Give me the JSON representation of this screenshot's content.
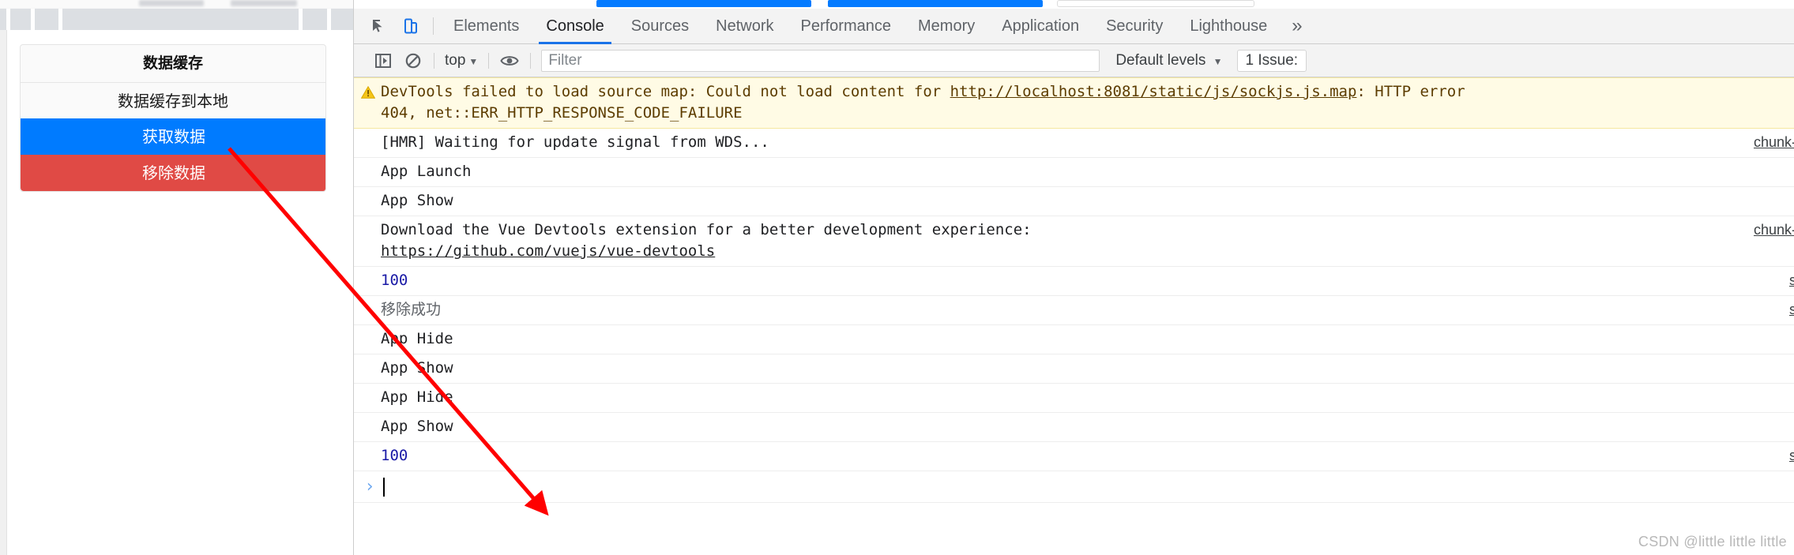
{
  "page": {
    "card_title": "数据缓存",
    "list_item": "数据缓存到本地",
    "primary_button": "获取数据",
    "danger_button": "移除数据",
    "primary_color": "#007bff",
    "danger_color": "#e04a45"
  },
  "devtools": {
    "tabs": [
      {
        "label": "Elements",
        "active": false
      },
      {
        "label": "Console",
        "active": true
      },
      {
        "label": "Sources",
        "active": false
      },
      {
        "label": "Network",
        "active": false
      },
      {
        "label": "Performance",
        "active": false
      },
      {
        "label": "Memory",
        "active": false
      },
      {
        "label": "Application",
        "active": false
      },
      {
        "label": "Security",
        "active": false
      },
      {
        "label": "Lighthouse",
        "active": false
      }
    ],
    "more_label": "»",
    "icons": {
      "inspect": "inspect-element-icon",
      "device": "device-toolbar-icon",
      "sidebar": "console-sidebar-icon",
      "clear": "clear-console-icon",
      "eye": "live-expression-icon"
    },
    "filterbar": {
      "context": "top",
      "context_caret": "▼",
      "filter_placeholder": "Filter",
      "filter_value": "",
      "levels": "Default levels",
      "levels_caret": "▼",
      "issues": "1 Issue:"
    },
    "console_rows": [
      {
        "type": "warning",
        "text_before": "DevTools failed to load source map: Could not load content for ",
        "link": "http://localhost:8081/static/js/sockjs.js.map",
        "text_after": ": HTTP error",
        "line2": "404, net::ERR_HTTP_RESPONSE_CODE_FAILURE",
        "source": ""
      },
      {
        "type": "log",
        "text": "[HMR] Waiting for update signal from WDS...",
        "source": "chunk-"
      },
      {
        "type": "log",
        "text": "App Launch",
        "source": ""
      },
      {
        "type": "log",
        "text": "App Show",
        "source": ""
      },
      {
        "type": "log",
        "text": "Download the Vue Devtools extension for a better development experience:",
        "link2": "https://github.com/vuejs/vue-devtools",
        "source": "chunk-"
      },
      {
        "type": "number",
        "text": "100",
        "source": "s"
      },
      {
        "type": "dim",
        "text": "移除成功",
        "source": "s"
      },
      {
        "type": "log",
        "text": "App Hide",
        "source": ""
      },
      {
        "type": "log",
        "text": "App Show",
        "source": ""
      },
      {
        "type": "log",
        "text": "App Hide",
        "source": ""
      },
      {
        "type": "log",
        "text": "App Show",
        "source": ""
      },
      {
        "type": "number",
        "text": "100",
        "source": "s"
      }
    ],
    "prompt": {
      "chevron": "›",
      "value": ""
    },
    "watermark": "CSDN @little little little"
  }
}
